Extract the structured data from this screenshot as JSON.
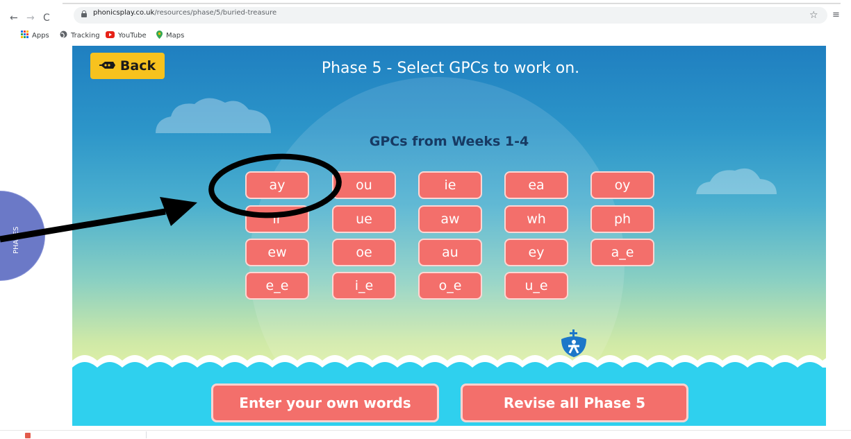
{
  "browser": {
    "url_host": "phonicsplay.co.uk",
    "url_path": "/resources/phase/5/buried-treasure",
    "bookmarks": [
      {
        "label": "Apps",
        "icon": "apps-grid-icon"
      },
      {
        "label": "Tracking",
        "icon": "globe-icon"
      },
      {
        "label": "YouTube",
        "icon": "youtube-icon"
      },
      {
        "label": "Maps",
        "icon": "maps-pin-icon"
      }
    ]
  },
  "game": {
    "back_label": "Back",
    "title": "Phase 5 - Select GPCs to work on.",
    "subtitle": "GPCs from Weeks 1-4",
    "gpcs": [
      [
        "ay",
        "ou",
        "ie",
        "ea",
        "oy"
      ],
      [
        "ir",
        "ue",
        "aw",
        "wh",
        "ph"
      ],
      [
        "ew",
        "oe",
        "au",
        "ey",
        "a_e"
      ],
      [
        "e_e",
        "i_e",
        "o_e",
        "u_e"
      ]
    ],
    "enter_words_label": "Enter your own words",
    "revise_label": "Revise all Phase 5"
  },
  "side_tab": {
    "label": "PHASES"
  },
  "colors": {
    "button": "#f36f6b",
    "back_button": "#f7c21e",
    "sky_top": "#1f7fc0",
    "sea": "#2fd0ee"
  }
}
